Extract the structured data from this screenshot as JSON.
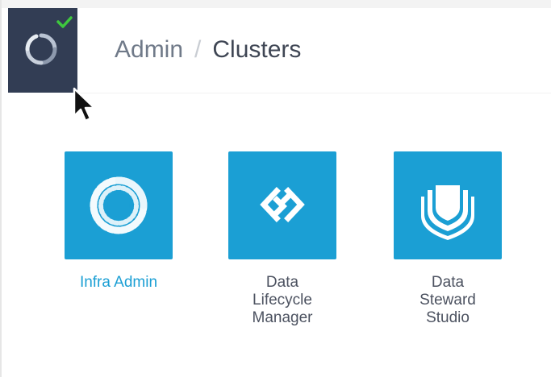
{
  "header": {
    "breadcrumb": {
      "parent": "Admin",
      "separator": "/",
      "current": "Clusters"
    }
  },
  "app_switcher": {
    "icon": "dataplane-logo-icon",
    "status_icon": "check-icon",
    "background_color": "#323d54",
    "status_color": "#3ec83e"
  },
  "apps": [
    {
      "label": "Infra Admin",
      "icon": "infra-admin-icon",
      "active": true
    },
    {
      "label": "Data\nLifecycle\nManager",
      "icon": "data-lifecycle-manager-icon",
      "active": false
    },
    {
      "label": "Data\nSteward\nStudio",
      "icon": "data-steward-studio-icon",
      "active": false
    }
  ],
  "colors": {
    "tile_background": "#1b9fd4",
    "active_label": "#1b9fd4",
    "label": "#4c5260"
  }
}
